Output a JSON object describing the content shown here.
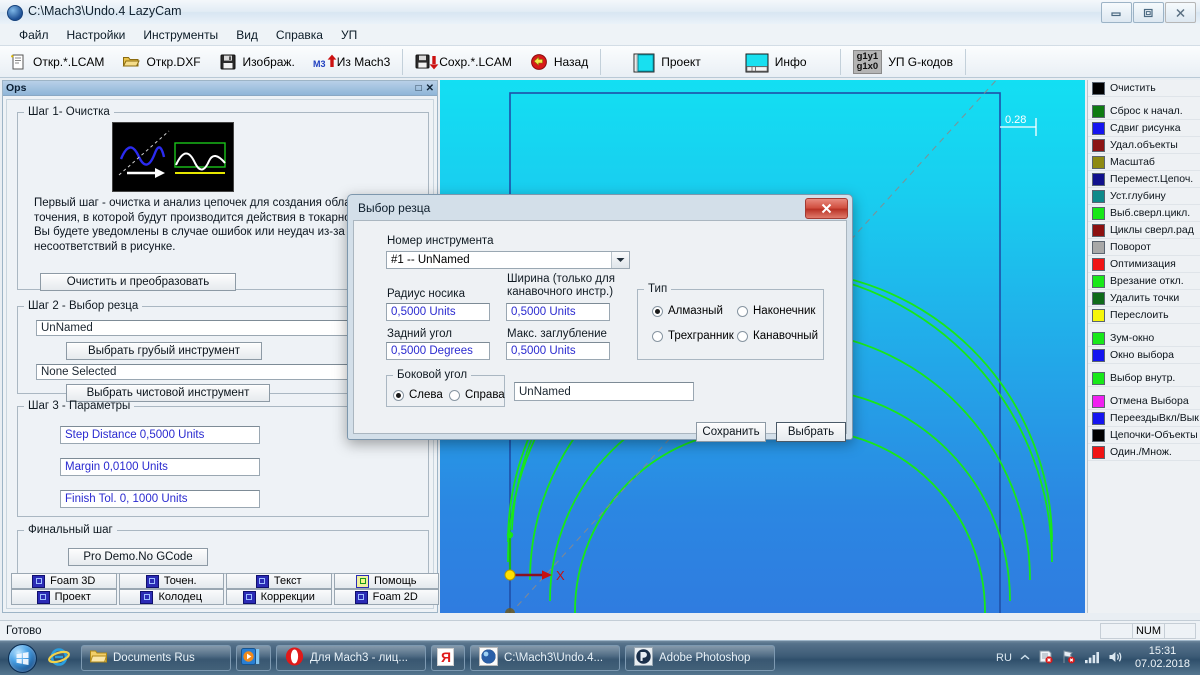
{
  "window": {
    "title": "C:\\Mach3\\Undo.4 LazyCam",
    "minimize": "minimize-button",
    "maximize": "maximize-button",
    "close": "close-button"
  },
  "menu": [
    {
      "label": "Файл"
    },
    {
      "label": "Настройки"
    },
    {
      "label": "Инструменты"
    },
    {
      "label": "Вид"
    },
    {
      "label": "Справка"
    },
    {
      "label": "УП"
    }
  ],
  "toolbar": [
    {
      "label": "Откр.*.LCAM",
      "icon": "open-lcam-icon"
    },
    {
      "label": "Откр.DXF",
      "icon": "open-dxf-icon"
    },
    {
      "label": "Изображ.",
      "icon": "save-image-icon"
    },
    {
      "label": "Из Mach3",
      "icon": "from-mach3-icon"
    },
    {
      "label": "Сохр.*.LCAM",
      "icon": "save-lcam-icon"
    },
    {
      "label": "Назад",
      "icon": "back-arrow-icon"
    },
    {
      "label": "Проект",
      "icon": "project-icon"
    },
    {
      "label": "Инфо",
      "icon": "info-icon"
    },
    {
      "label": "УП G-кодов",
      "icon": "gcode-icon",
      "glyph_top": "g1y1",
      "glyph_bottom": "g1x0"
    }
  ],
  "ops_panel": {
    "title": "Ops",
    "restore_glyph": "□",
    "close_glyph": "✕",
    "step1": {
      "legend": "Шаг 1- Очистка",
      "description": "Первый шаг - очистка и анализ цепочек для создания области точения, в которой будут производится действия в токарном профиле. Вы будете уведомлены в случае ошибок или неудач из-за несоответствий в рисунке.",
      "button": "Очистить и преобразовать"
    },
    "step2": {
      "legend": "Шаг 2 - Выбор резца",
      "rough_tool_value": "UnNamed",
      "rough_tool_button": "Выбрать грубый инструмент",
      "finish_tool_value": "None Selected",
      "finish_tool_button": "Выбрать чистовой инструмент"
    },
    "step3": {
      "legend": "Шаг 3  - Параметры",
      "fields": [
        "Step Distance 0,5000 Units",
        "Margin 0,0100 Units",
        "Finish Tol. 0, 1000 Units"
      ]
    },
    "final": {
      "legend": "Финальный шаг",
      "button": "Pro Demo.No GCode"
    },
    "tabs": [
      {
        "label": "Foam 3D",
        "icon": "foam3d-icon"
      },
      {
        "label": "Точен.",
        "icon": "turning-icon"
      },
      {
        "label": "Текст",
        "icon": "text-icon"
      },
      {
        "label": "Помощь",
        "icon": "help-icon"
      },
      {
        "label": "Проект",
        "icon": "project-tab-icon"
      },
      {
        "label": "Колодец",
        "icon": "pocket-icon"
      },
      {
        "label": "Коррекции",
        "icon": "offsets-icon"
      },
      {
        "label": "Foam 2D",
        "icon": "foam2d-icon"
      }
    ]
  },
  "canvas": {
    "dimension_label": "0.28",
    "x_axis_label": "X",
    "colors": {
      "bg_top": "#13dff3",
      "bg_bottom": "#2f7ce0",
      "chain": "#18e818",
      "boundary": "#1f4fa8",
      "origin": "#ffe000",
      "axis_x": "#c81010"
    }
  },
  "sidebar": [
    {
      "label": "Очистить",
      "color": "#000000"
    },
    {
      "gap": true
    },
    {
      "label": "Сброс к начал.",
      "color": "#0e7a12"
    },
    {
      "label": "Сдвиг рисунка",
      "color": "#1414f0"
    },
    {
      "label": "Удал.объекты",
      "color": "#8c1414"
    },
    {
      "label": "Масштаб",
      "color": "#8e8a12"
    },
    {
      "label": "Перемест.Цепоч.",
      "color": "#10108c"
    },
    {
      "label": "Уст.глубину",
      "color": "#0f8a8a"
    },
    {
      "label": "Выб.сверл.цикл.",
      "color": "#18e818"
    },
    {
      "label": "Циклы сверл.рад",
      "color": "#8c1010"
    },
    {
      "label": "Поворот",
      "color": "#a8a8a8"
    },
    {
      "label": "Оптимизация",
      "color": "#f01414"
    },
    {
      "label": "Врезание откл.",
      "color": "#18e818"
    },
    {
      "label": "Удалить точки",
      "color": "#0e6a18"
    },
    {
      "label": "Переслоить",
      "color": "#f6f60a"
    },
    {
      "gap": true
    },
    {
      "label": "Зум-окно",
      "color": "#18e818"
    },
    {
      "label": "Окно выбора",
      "color": "#1414f0"
    },
    {
      "gap": true
    },
    {
      "label": "Выбор внутр.",
      "color": "#18e818"
    },
    {
      "gap": true
    },
    {
      "label": "Отмена Выбора",
      "color": "#f020f0"
    },
    {
      "label": "ПереездыВкл/Вык",
      "color": "#1414f0"
    },
    {
      "label": "Цепочки-Объекты",
      "color": "#000000"
    },
    {
      "label": "Один./Множ.",
      "color": "#f01414"
    }
  ],
  "statusbar": {
    "text": "Готово",
    "cells": [
      "",
      "NUM",
      ""
    ]
  },
  "dialog": {
    "title": "Выбор резца",
    "close_glyph": "✕",
    "tool_number_label": "Номер инструмента",
    "tool_number_value": "#1 -- UnNamed",
    "nose_radius_label": "Радиус носика",
    "nose_radius_value": "0,5000 Units",
    "width_label": "Ширина (только для канавочного инстр.)",
    "width_value": "0,5000 Units",
    "back_angle_label": "Задний угол",
    "back_angle_value": "0,5000 Degrees",
    "max_depth_label": "Макс. заглубление",
    "max_depth_value": "0,5000 Units",
    "type_legend": "Тип",
    "type_options": [
      {
        "label": "Алмазный",
        "selected": true
      },
      {
        "label": "Наконечник",
        "selected": false
      },
      {
        "label": "Трехгранник",
        "selected": false
      },
      {
        "label": "Канавочный",
        "selected": false
      }
    ],
    "side_angle_legend": "Боковой угол",
    "side_angle_options": [
      {
        "label": "Слева",
        "selected": true
      },
      {
        "label": "Справа",
        "selected": false
      }
    ],
    "name_value": "UnNamed",
    "save_button": "Сохранить",
    "select_button": "Выбрать"
  },
  "taskbar": {
    "start_icon": "windows-orb-icon",
    "quicklaunch": [
      {
        "icon": "internet-explorer-icon"
      }
    ],
    "tasks": [
      {
        "label": "Documents Rus",
        "icon": "folder-icon"
      },
      {
        "label": "",
        "icon": "media-player-icon"
      },
      {
        "label": "Для Mach3 - лиц...",
        "icon": "opera-icon"
      },
      {
        "label": "",
        "icon": "yandex-icon"
      },
      {
        "label": "C:\\Mach3\\Undo.4...",
        "icon": "lazycam-icon"
      },
      {
        "label": "Adobe Photoshop",
        "icon": "photoshop-icon"
      }
    ],
    "tray": {
      "language": "RU",
      "show_hidden": "chevron-up-icon",
      "icons": [
        "security-icon",
        "flag-icon",
        "network-icon",
        "volume-icon"
      ],
      "time": "15:31",
      "date": "07.02.2018"
    }
  }
}
